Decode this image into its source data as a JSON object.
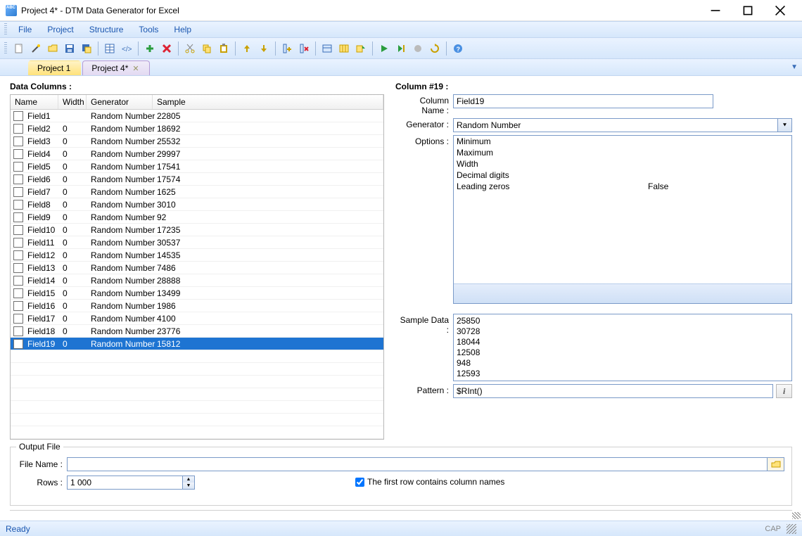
{
  "window": {
    "title": "Project 4* - DTM Data Generator for Excel"
  },
  "menu": {
    "file": "File",
    "project": "Project",
    "structure": "Structure",
    "tools": "Tools",
    "help": "Help"
  },
  "tabs": {
    "tab1": "Project 1",
    "tab2": "Project 4*"
  },
  "left": {
    "header": "Data Columns :",
    "cols": {
      "name": "Name",
      "width": "Width",
      "generator": "Generator",
      "sample": "Sample"
    },
    "rows": [
      {
        "name": "Field1",
        "width": "",
        "gen": "Random Number",
        "sample": "22805"
      },
      {
        "name": "Field2",
        "width": "0",
        "gen": "Random Number",
        "sample": "18692"
      },
      {
        "name": "Field3",
        "width": "0",
        "gen": "Random Number",
        "sample": "25532"
      },
      {
        "name": "Field4",
        "width": "0",
        "gen": "Random Number",
        "sample": "29997"
      },
      {
        "name": "Field5",
        "width": "0",
        "gen": "Random Number",
        "sample": "17541"
      },
      {
        "name": "Field6",
        "width": "0",
        "gen": "Random Number",
        "sample": "17574"
      },
      {
        "name": "Field7",
        "width": "0",
        "gen": "Random Number",
        "sample": "1625"
      },
      {
        "name": "Field8",
        "width": "0",
        "gen": "Random Number",
        "sample": "3010"
      },
      {
        "name": "Field9",
        "width": "0",
        "gen": "Random Number",
        "sample": "92"
      },
      {
        "name": "Field10",
        "width": "0",
        "gen": "Random Number",
        "sample": "17235"
      },
      {
        "name": "Field11",
        "width": "0",
        "gen": "Random Number",
        "sample": "30537"
      },
      {
        "name": "Field12",
        "width": "0",
        "gen": "Random Number",
        "sample": "14535"
      },
      {
        "name": "Field13",
        "width": "0",
        "gen": "Random Number",
        "sample": "7486"
      },
      {
        "name": "Field14",
        "width": "0",
        "gen": "Random Number",
        "sample": "28888"
      },
      {
        "name": "Field15",
        "width": "0",
        "gen": "Random Number",
        "sample": "13499"
      },
      {
        "name": "Field16",
        "width": "0",
        "gen": "Random Number",
        "sample": "1986"
      },
      {
        "name": "Field17",
        "width": "0",
        "gen": "Random Number",
        "sample": "4100"
      },
      {
        "name": "Field18",
        "width": "0",
        "gen": "Random Number",
        "sample": "23776"
      },
      {
        "name": "Field19",
        "width": "0",
        "gen": "Random Number",
        "sample": "15812"
      }
    ],
    "selected_index": 18
  },
  "right": {
    "header": "Column #19 :",
    "labels": {
      "column_name": "Column Name :",
      "generator": "Generator :",
      "options": "Options :",
      "sample_data": "Sample Data :",
      "pattern": "Pattern :"
    },
    "column_name": "Field19",
    "generator": "Random Number",
    "options": [
      {
        "k": "Minimum",
        "v": ""
      },
      {
        "k": "Maximum",
        "v": ""
      },
      {
        "k": "Width",
        "v": ""
      },
      {
        "k": "Decimal digits",
        "v": ""
      },
      {
        "k": "Leading zeros",
        "v": "False"
      }
    ],
    "sample_data": [
      "25850",
      "30728",
      "18044",
      "12508",
      "948",
      "12593"
    ],
    "pattern": "$RInt()",
    "info_btn": "i"
  },
  "output": {
    "legend": "Output File",
    "filename_label": "File Name :",
    "filename": "",
    "rows_label": "Rows :",
    "rows": "1 000",
    "checkbox_label": "The first row contains column names",
    "checked": true
  },
  "status": {
    "ready": "Ready",
    "cap": "CAP"
  }
}
